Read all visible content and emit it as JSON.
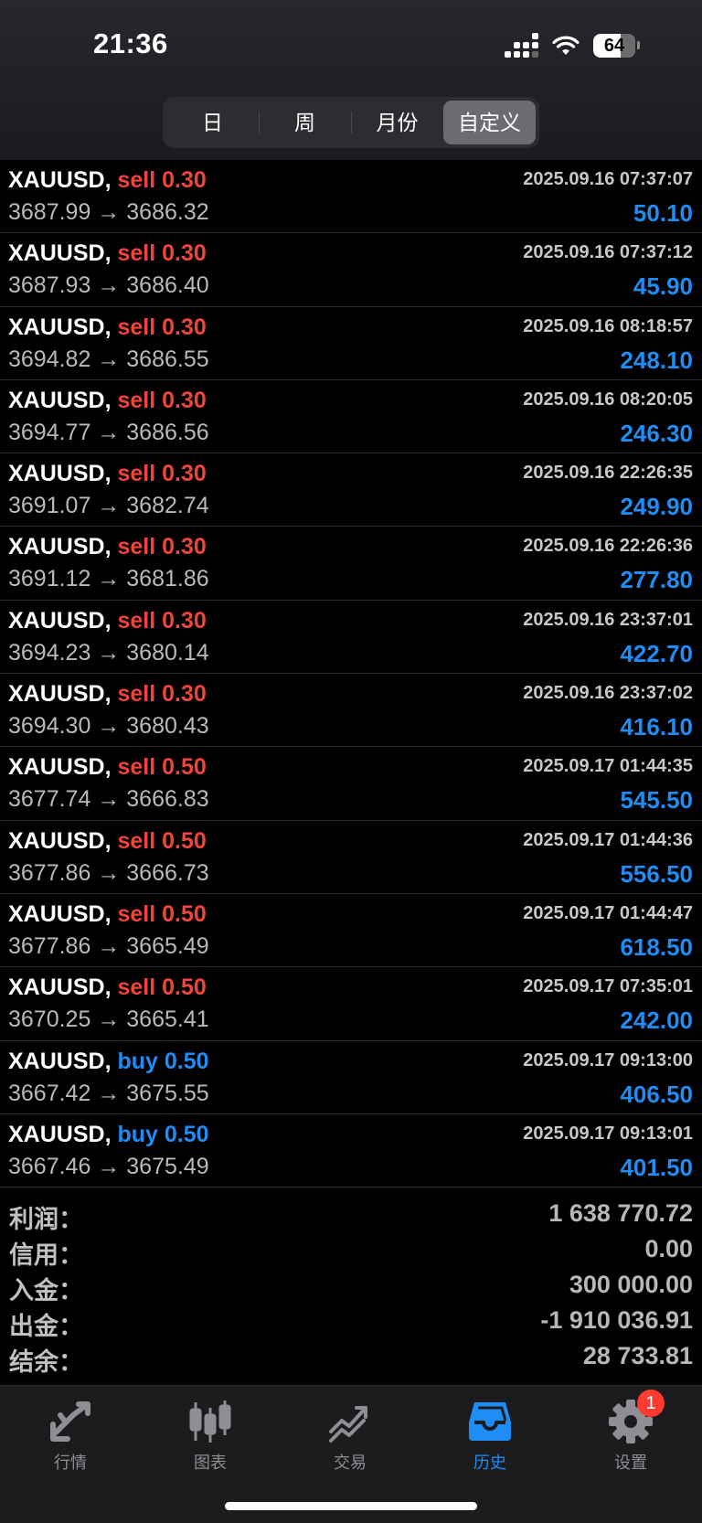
{
  "status_bar": {
    "time": "21:36",
    "battery": "64"
  },
  "segments": [
    {
      "label": "日",
      "active": false
    },
    {
      "label": "周",
      "active": false
    },
    {
      "label": "月份",
      "active": false
    },
    {
      "label": "自定义",
      "active": true
    }
  ],
  "deals": [
    {
      "symbol": "XAUUSD,",
      "side": "sell",
      "volume": "0.30",
      "datetime": "2025.09.16 07:37:07",
      "prices": "3687.99 → 3686.32",
      "profit": "50.10"
    },
    {
      "symbol": "XAUUSD,",
      "side": "sell",
      "volume": "0.30",
      "datetime": "2025.09.16 07:37:12",
      "prices": "3687.93 → 3686.40",
      "profit": "45.90"
    },
    {
      "symbol": "XAUUSD,",
      "side": "sell",
      "volume": "0.30",
      "datetime": "2025.09.16 08:18:57",
      "prices": "3694.82 → 3686.55",
      "profit": "248.10"
    },
    {
      "symbol": "XAUUSD,",
      "side": "sell",
      "volume": "0.30",
      "datetime": "2025.09.16 08:20:05",
      "prices": "3694.77 → 3686.56",
      "profit": "246.30"
    },
    {
      "symbol": "XAUUSD,",
      "side": "sell",
      "volume": "0.30",
      "datetime": "2025.09.16 22:26:35",
      "prices": "3691.07 → 3682.74",
      "profit": "249.90"
    },
    {
      "symbol": "XAUUSD,",
      "side": "sell",
      "volume": "0.30",
      "datetime": "2025.09.16 22:26:36",
      "prices": "3691.12 → 3681.86",
      "profit": "277.80"
    },
    {
      "symbol": "XAUUSD,",
      "side": "sell",
      "volume": "0.30",
      "datetime": "2025.09.16 23:37:01",
      "prices": "3694.23 → 3680.14",
      "profit": "422.70"
    },
    {
      "symbol": "XAUUSD,",
      "side": "sell",
      "volume": "0.30",
      "datetime": "2025.09.16 23:37:02",
      "prices": "3694.30 → 3680.43",
      "profit": "416.10"
    },
    {
      "symbol": "XAUUSD,",
      "side": "sell",
      "volume": "0.50",
      "datetime": "2025.09.17 01:44:35",
      "prices": "3677.74 → 3666.83",
      "profit": "545.50"
    },
    {
      "symbol": "XAUUSD,",
      "side": "sell",
      "volume": "0.50",
      "datetime": "2025.09.17 01:44:36",
      "prices": "3677.86 → 3666.73",
      "profit": "556.50"
    },
    {
      "symbol": "XAUUSD,",
      "side": "sell",
      "volume": "0.50",
      "datetime": "2025.09.17 01:44:47",
      "prices": "3677.86 → 3665.49",
      "profit": "618.50"
    },
    {
      "symbol": "XAUUSD,",
      "side": "sell",
      "volume": "0.50",
      "datetime": "2025.09.17 07:35:01",
      "prices": "3670.25 → 3665.41",
      "profit": "242.00"
    },
    {
      "symbol": "XAUUSD,",
      "side": "buy",
      "volume": "0.50",
      "datetime": "2025.09.17 09:13:00",
      "prices": "3667.42 → 3675.55",
      "profit": "406.50"
    },
    {
      "symbol": "XAUUSD,",
      "side": "buy",
      "volume": "0.50",
      "datetime": "2025.09.17 09:13:01",
      "prices": "3667.46 → 3675.49",
      "profit": "401.50"
    }
  ],
  "summary": [
    {
      "label": "利润：",
      "value": "1 638 770.72"
    },
    {
      "label": "信用：",
      "value": "0.00"
    },
    {
      "label": "入金：",
      "value": "300 000.00"
    },
    {
      "label": "出金：",
      "value": "-1 910 036.91"
    },
    {
      "label": "结余：",
      "value": "28 733.81"
    }
  ],
  "tabs": [
    {
      "label": "行情",
      "icon": "quotes-icon",
      "active": false
    },
    {
      "label": "图表",
      "icon": "chart-icon",
      "active": false
    },
    {
      "label": "交易",
      "icon": "trade-icon",
      "active": false
    },
    {
      "label": "历史",
      "icon": "history-icon",
      "active": true
    },
    {
      "label": "设置",
      "icon": "settings-icon",
      "active": false,
      "badge": "1"
    }
  ],
  "colors": {
    "sell": "#f0453a",
    "buy": "#1e8df5",
    "profit": "#1e8df5",
    "active_tab": "#1e8df5",
    "badge": "#ff3b30"
  }
}
